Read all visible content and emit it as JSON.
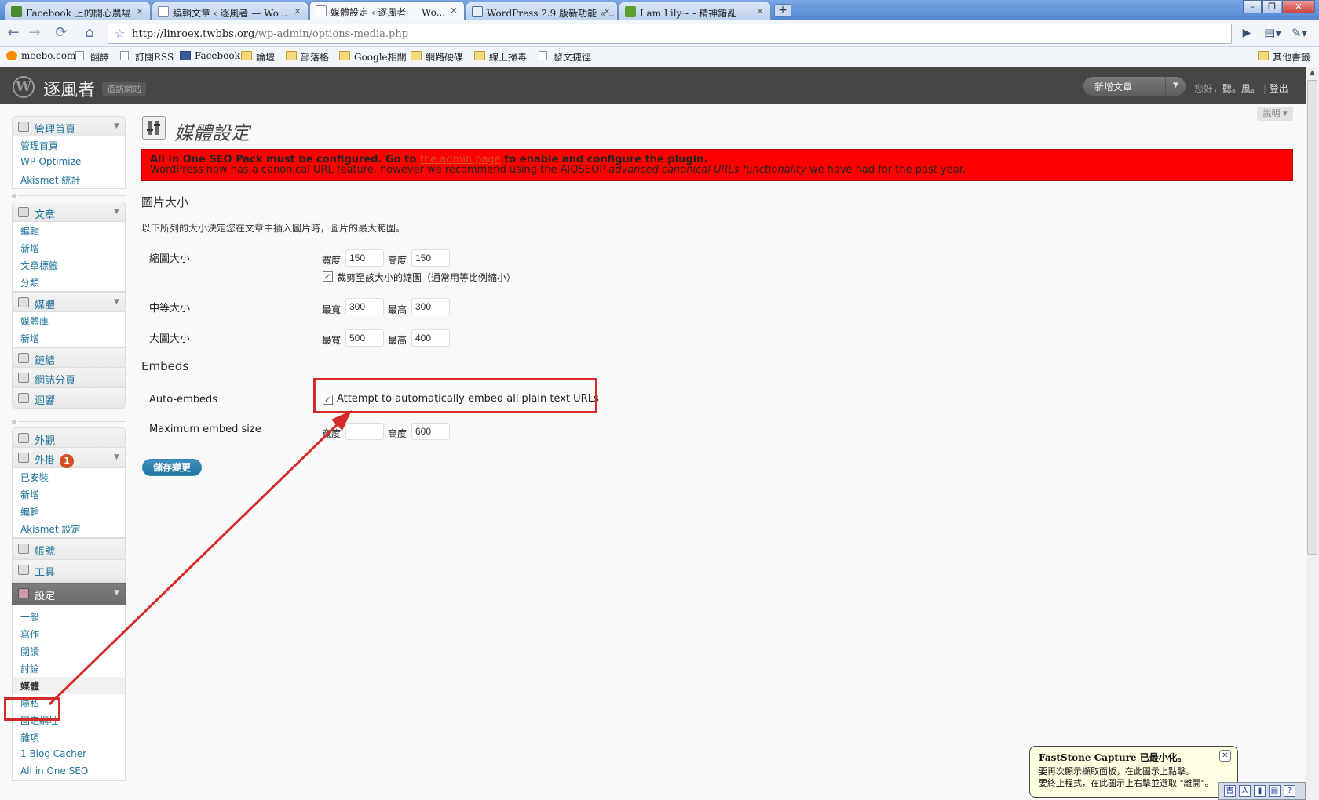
{
  "browser": {
    "tabs": [
      {
        "title": "Facebook 上的開心農場",
        "close": "×"
      },
      {
        "title": "編輯文章 ‹ 逐風者 — Wo...",
        "close": "×"
      },
      {
        "title": "媒體設定 ‹ 逐風者 — Wo...",
        "close": "×"
      },
      {
        "title": "WordPress 2.9 版新功能 « ...",
        "close": "×"
      },
      {
        "title": "I am Lily~ - 精神錯亂",
        "close": "×"
      }
    ],
    "new_tab": "+",
    "window_buttons": [
      "–",
      "❐",
      "✕"
    ],
    "url_host": "http://linroex.twbbs.org",
    "url_path": "/wp-admin/options-media.php",
    "bookmarks": [
      {
        "label": "meebo.com",
        "icon": "meebo"
      },
      {
        "label": "翻譯",
        "icon": "page"
      },
      {
        "label": "訂閱RSS",
        "icon": "page"
      },
      {
        "label": "Facebook",
        "icon": "fb"
      },
      {
        "label": "論壇",
        "icon": "folder"
      },
      {
        "label": "部落格",
        "icon": "folder"
      },
      {
        "label": "Google相關",
        "icon": "folder"
      },
      {
        "label": "網路硬碟",
        "icon": "folder"
      },
      {
        "label": "線上掃毒",
        "icon": "folder"
      },
      {
        "label": "發文捷徑",
        "icon": "page"
      }
    ],
    "other_bookmarks": "其他書籤"
  },
  "wp": {
    "site_name": "逐風者",
    "visit_site": "造訪網站",
    "favorite_action": "新增文章",
    "howdy": "您好，",
    "user": "聽。風。",
    "logout": "登出",
    "help": "說明 ▾"
  },
  "menu": {
    "dashboard": {
      "label": "管理首頁",
      "items": [
        "管理首頁",
        "WP-Optimize",
        "Akismet 統計"
      ]
    },
    "posts": {
      "label": "文章",
      "items": [
        "編輯",
        "新增",
        "文章標籤",
        "分類"
      ]
    },
    "media": {
      "label": "媒體",
      "items": [
        "媒體庫",
        "新增"
      ]
    },
    "links": {
      "label": "鏈結"
    },
    "pages": {
      "label": "網誌分頁"
    },
    "comments": {
      "label": "迴響"
    },
    "appearance": {
      "label": "外觀"
    },
    "plugins": {
      "label": "外掛",
      "badge": "1",
      "items": [
        "已安裝",
        "新增",
        "編輯",
        "Akismet 設定"
      ]
    },
    "users": {
      "label": "帳號"
    },
    "tools": {
      "label": "工具"
    },
    "settings": {
      "label": "設定",
      "items": [
        "一般",
        "寫作",
        "閱讀",
        "討論",
        "媒體",
        "隱私",
        "固定網址",
        "雜項",
        "1 Blog Cacher",
        "All in One SEO"
      ]
    }
  },
  "page": {
    "title": "媒體設定",
    "notice": {
      "bold_a": "All in One SEO Pack must be configured. Go to",
      "link": "the admin page",
      "bold_b": "to enable and configure the plugin.",
      "line2_a": "WordPress now has a canonical URL feature, however we recommend using the AIOSEOP",
      "line2_em": "advanced canonical URLs functionality",
      "line2_b": "we have had for the past year."
    },
    "image_sizes": {
      "heading": "圖片大小",
      "description": "以下所列的大小決定您在文章中插入圖片時，圖片的最大範圍。",
      "thumbnail": {
        "label": "縮圖大小",
        "width_label": "寬度",
        "width": "150",
        "height_label": "高度",
        "height": "150",
        "crop_label": "裁剪至該大小的縮圖（通常用等比例縮小）",
        "crop_checked": true
      },
      "medium": {
        "label": "中等大小",
        "width_label": "最寬",
        "width": "300",
        "height_label": "最高",
        "height": "300"
      },
      "large": {
        "label": "大圖大小",
        "width_label": "最寬",
        "width": "500",
        "height_label": "最高",
        "height": "400"
      }
    },
    "embeds": {
      "heading": "Embeds",
      "auto_label": "Auto-embeds",
      "auto_checkbox": "Attempt to automatically embed all plain text URLs",
      "auto_checked": true,
      "max_label": "Maximum embed size",
      "width_label": "寬度",
      "width": "",
      "height_label": "高度",
      "height": "600"
    },
    "save": "儲存變更"
  },
  "popup": {
    "title": "FastStone Capture 已最小化。",
    "line1": "要再次顯示擷取面板，在此圖示上點擊。",
    "line2": "要終止程式，在此圖示上右擊並選取 \"離開\"。",
    "close": "✕"
  },
  "colors": {
    "accent": "#21759b",
    "notice_bg": "#ff0000",
    "annotation": "#d42a2a",
    "header": "#464646"
  }
}
